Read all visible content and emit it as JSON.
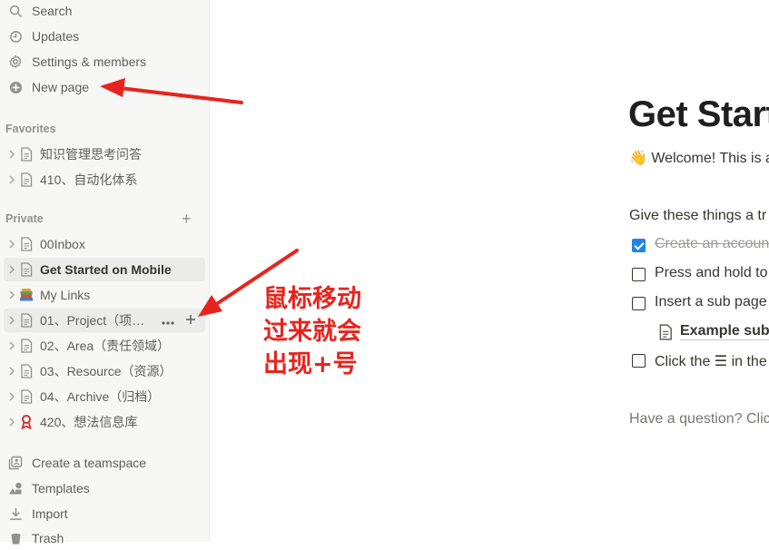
{
  "sidebar": {
    "top_items": [
      {
        "icon": "search-icon",
        "label": "Search"
      },
      {
        "icon": "clock-icon",
        "label": "Updates"
      },
      {
        "icon": "gear-icon",
        "label": "Settings & members"
      },
      {
        "icon": "plus-circle-icon",
        "label": "New page"
      }
    ],
    "favorites_heading": "Favorites",
    "favorites": [
      {
        "icon": "page-icon",
        "label": "知识管理思考问答"
      },
      {
        "icon": "page-icon",
        "label": "410、自动化体系"
      }
    ],
    "private_heading": "Private",
    "private": [
      {
        "icon": "page-icon",
        "label": "00Inbox"
      },
      {
        "icon": "page-icon",
        "label": "Get Started on Mobile",
        "active": true
      },
      {
        "icon": "books-icon",
        "label": "My Links"
      },
      {
        "icon": "page-icon",
        "label": "01、Project（项…",
        "hover": true
      },
      {
        "icon": "page-icon",
        "label": "02、Area（责任领域）"
      },
      {
        "icon": "page-icon",
        "label": "03、Resource（资源）"
      },
      {
        "icon": "page-icon",
        "label": "04、Archive（归档）"
      },
      {
        "icon": "ribbon-icon",
        "label": "420、想法信息库"
      }
    ],
    "bottom_items": [
      {
        "icon": "teamspace-icon",
        "label": "Create a teamspace"
      },
      {
        "icon": "templates-icon",
        "label": "Templates"
      },
      {
        "icon": "import-icon",
        "label": "Import"
      },
      {
        "icon": "trash-icon",
        "label": "Trash"
      }
    ]
  },
  "main": {
    "title": "Get Start",
    "welcome": "👋 Welcome! This is a",
    "intro": "Give these things a tr",
    "todos": [
      {
        "text": "Create an accoun",
        "checked": true
      },
      {
        "text": "Press and hold to",
        "checked": false
      },
      {
        "text": "Insert a sub page",
        "checked": false
      },
      {
        "text": "Click the ☰ in the",
        "checked": false
      }
    ],
    "sub_page": "Example sub",
    "question": "Have a question? Clic"
  },
  "annotation": {
    "lines": [
      "鼠标移动",
      "过来就会",
      "出现+号"
    ],
    "color": "#e8231d"
  }
}
